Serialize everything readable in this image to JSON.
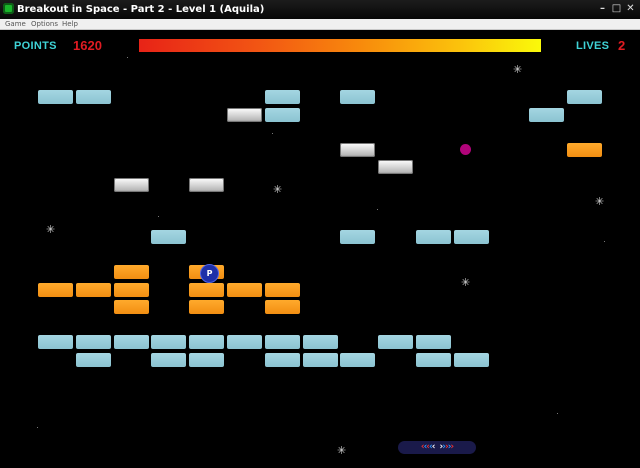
{
  "window": {
    "title": "Breakout in Space - Part 2 - Level 1 (Aquila)"
  },
  "menu": {
    "items": [
      "Game",
      "Options",
      "Help"
    ]
  },
  "hud": {
    "points_label": "POINTS",
    "points": "1620",
    "lives_label": "LIVES",
    "lives": "2"
  },
  "powerup": {
    "label": "P"
  },
  "colors": {
    "brick_blue": "#9acfdc",
    "brick_orange": "#f79a1a",
    "brick_silver": "#e6e6e6",
    "ball": "#b1047a",
    "hud_label": "#3fd3d7",
    "hud_value": "#e01b22"
  },
  "bricks": [
    {
      "c": 0,
      "r": 0,
      "t": "blue"
    },
    {
      "c": 1,
      "r": 0,
      "t": "blue"
    },
    {
      "c": 6,
      "r": 0,
      "t": "blue"
    },
    {
      "c": 8,
      "r": 0,
      "t": "blue"
    },
    {
      "c": 14,
      "r": 0,
      "t": "blue"
    },
    {
      "c": 5,
      "r": 1,
      "t": "silver"
    },
    {
      "c": 6,
      "r": 1,
      "t": "blue"
    },
    {
      "c": 13,
      "r": 1,
      "t": "blue"
    },
    {
      "c": 8,
      "r": 3,
      "t": "silver"
    },
    {
      "c": 14,
      "r": 3,
      "t": "orange"
    },
    {
      "c": 9,
      "r": 4,
      "t": "silver"
    },
    {
      "c": 2,
      "r": 5,
      "t": "silver"
    },
    {
      "c": 4,
      "r": 5,
      "t": "silver"
    },
    {
      "c": 3,
      "r": 8,
      "t": "blue"
    },
    {
      "c": 8,
      "r": 8,
      "t": "blue"
    },
    {
      "c": 10,
      "r": 8,
      "t": "blue"
    },
    {
      "c": 11,
      "r": 8,
      "t": "blue"
    },
    {
      "c": 2,
      "r": 10,
      "t": "orange"
    },
    {
      "c": 4,
      "r": 10,
      "t": "orange"
    },
    {
      "c": 0,
      "r": 11,
      "t": "orange"
    },
    {
      "c": 1,
      "r": 11,
      "t": "orange"
    },
    {
      "c": 2,
      "r": 11,
      "t": "orange"
    },
    {
      "c": 4,
      "r": 11,
      "t": "orange"
    },
    {
      "c": 5,
      "r": 11,
      "t": "orange"
    },
    {
      "c": 6,
      "r": 11,
      "t": "orange"
    },
    {
      "c": 2,
      "r": 12,
      "t": "orange"
    },
    {
      "c": 4,
      "r": 12,
      "t": "orange"
    },
    {
      "c": 6,
      "r": 12,
      "t": "orange"
    },
    {
      "c": 0,
      "r": 14,
      "t": "blue"
    },
    {
      "c": 1,
      "r": 14,
      "t": "blue"
    },
    {
      "c": 2,
      "r": 14,
      "t": "blue"
    },
    {
      "c": 3,
      "r": 14,
      "t": "blue"
    },
    {
      "c": 4,
      "r": 14,
      "t": "blue"
    },
    {
      "c": 5,
      "r": 14,
      "t": "blue"
    },
    {
      "c": 6,
      "r": 14,
      "t": "blue"
    },
    {
      "c": 7,
      "r": 14,
      "t": "blue"
    },
    {
      "c": 9,
      "r": 14,
      "t": "blue"
    },
    {
      "c": 10,
      "r": 14,
      "t": "blue"
    },
    {
      "c": 1,
      "r": 15,
      "t": "blue"
    },
    {
      "c": 3,
      "r": 15,
      "t": "blue"
    },
    {
      "c": 4,
      "r": 15,
      "t": "blue"
    },
    {
      "c": 6,
      "r": 15,
      "t": "blue"
    },
    {
      "c": 7,
      "r": 15,
      "t": "blue"
    },
    {
      "c": 8,
      "r": 15,
      "t": "blue"
    },
    {
      "c": 10,
      "r": 15,
      "t": "blue"
    },
    {
      "c": 11,
      "r": 15,
      "t": "blue"
    }
  ]
}
